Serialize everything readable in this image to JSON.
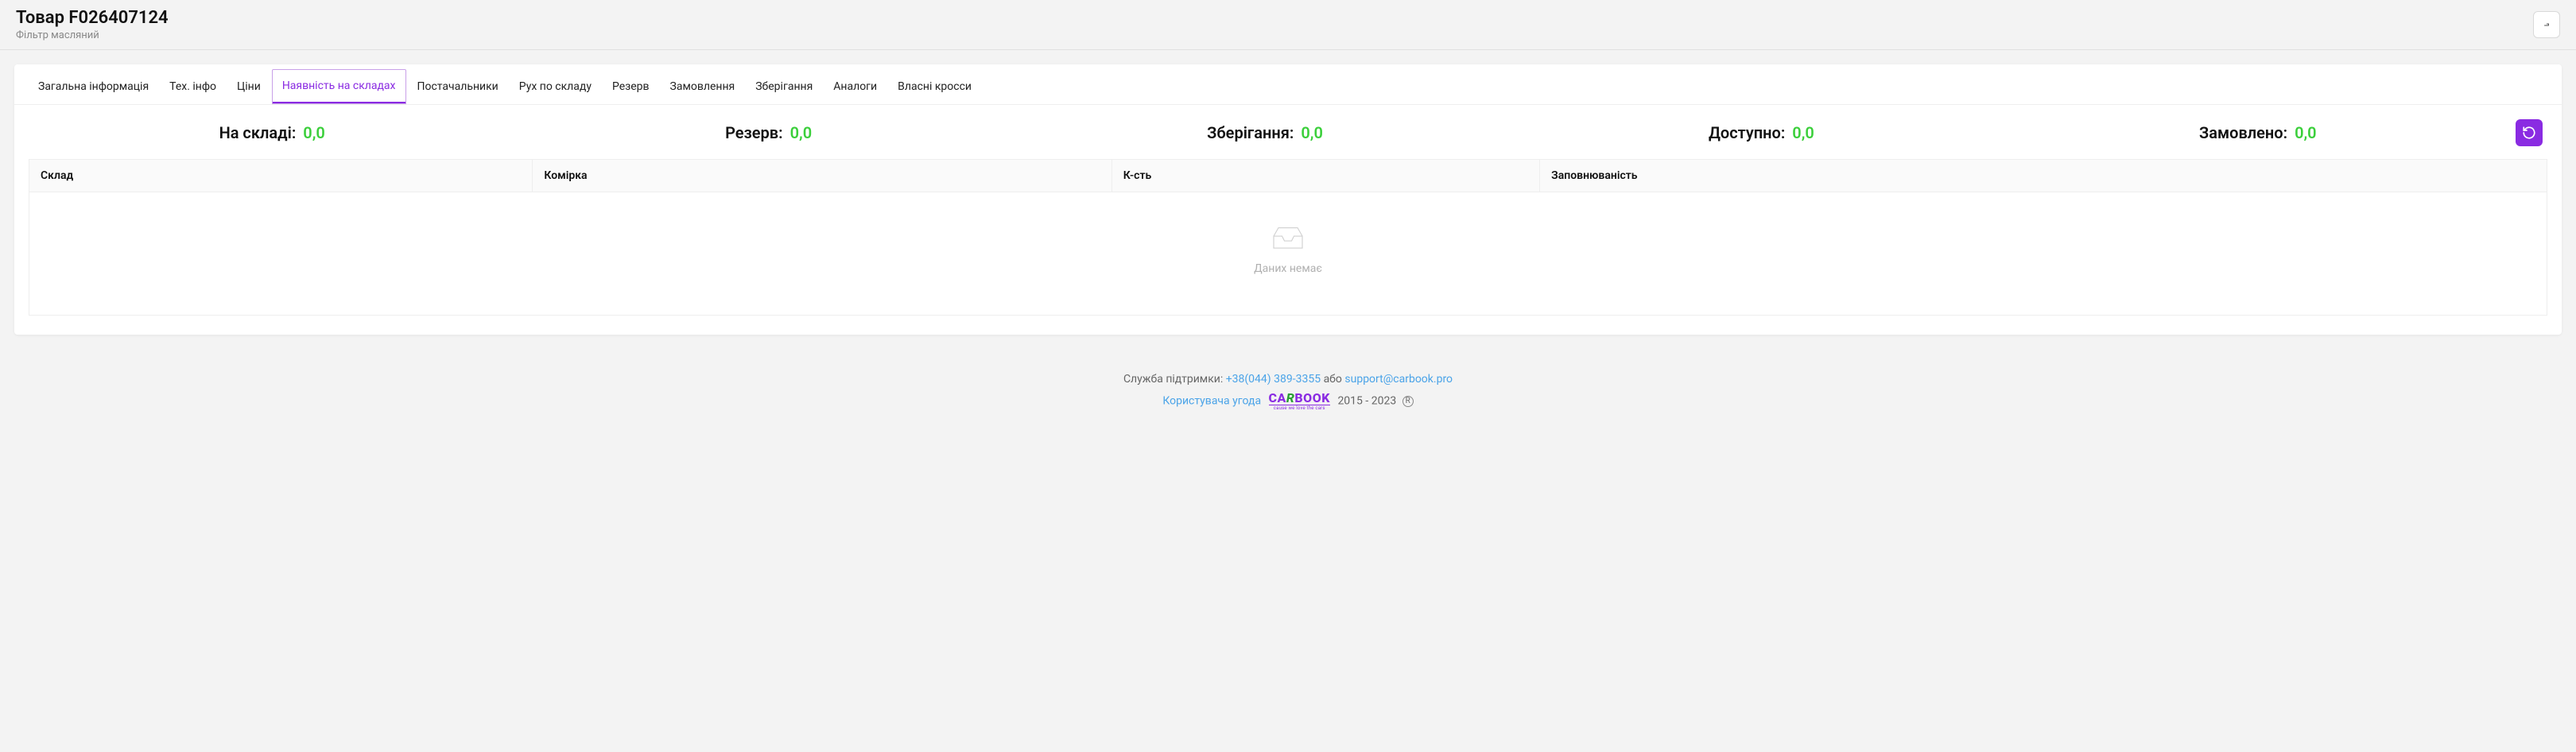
{
  "header": {
    "title": "Товар F026407124",
    "subtitle": "Фільтр масляний"
  },
  "tabs": [
    {
      "id": "general",
      "label": "Загальна інформація"
    },
    {
      "id": "tech",
      "label": "Тех. інфо"
    },
    {
      "id": "prices",
      "label": "Ціни"
    },
    {
      "id": "stock",
      "label": "Наявність на складах",
      "active": true
    },
    {
      "id": "suppliers",
      "label": "Постачальники"
    },
    {
      "id": "movement",
      "label": "Рух по складу"
    },
    {
      "id": "reserve",
      "label": "Резерв"
    },
    {
      "id": "orders",
      "label": "Замовлення"
    },
    {
      "id": "storage",
      "label": "Зберігання"
    },
    {
      "id": "analogues",
      "label": "Аналоги"
    },
    {
      "id": "crosses",
      "label": "Власні кросси"
    }
  ],
  "summary": {
    "in_stock_label": "На складі:",
    "in_stock_value": "0,0",
    "reserve_label": "Резерв:",
    "reserve_value": "0,0",
    "storage_label": "Зберігання:",
    "storage_value": "0,0",
    "available_label": "Доступно:",
    "available_value": "0,0",
    "ordered_label": "Замовлено:",
    "ordered_value": "0,0"
  },
  "table": {
    "columns": {
      "warehouse": "Склад",
      "cell": "Комірка",
      "qty": "К-сть",
      "fill": "Заповнюваність"
    },
    "empty": "Даних немає",
    "rows": []
  },
  "footer": {
    "support_label": "Служба підтримки: ",
    "phone": "+38(044) 389-3355",
    "or": " або ",
    "email": "support@carbook.pro",
    "agreement": "Користувача угода",
    "logo_big1": "CA",
    "logo_big2": "R",
    "logo_big3": "BOOK",
    "logo_tag": "cause we love the cars",
    "years": " 2015 - 2023 ",
    "reg": "R"
  }
}
